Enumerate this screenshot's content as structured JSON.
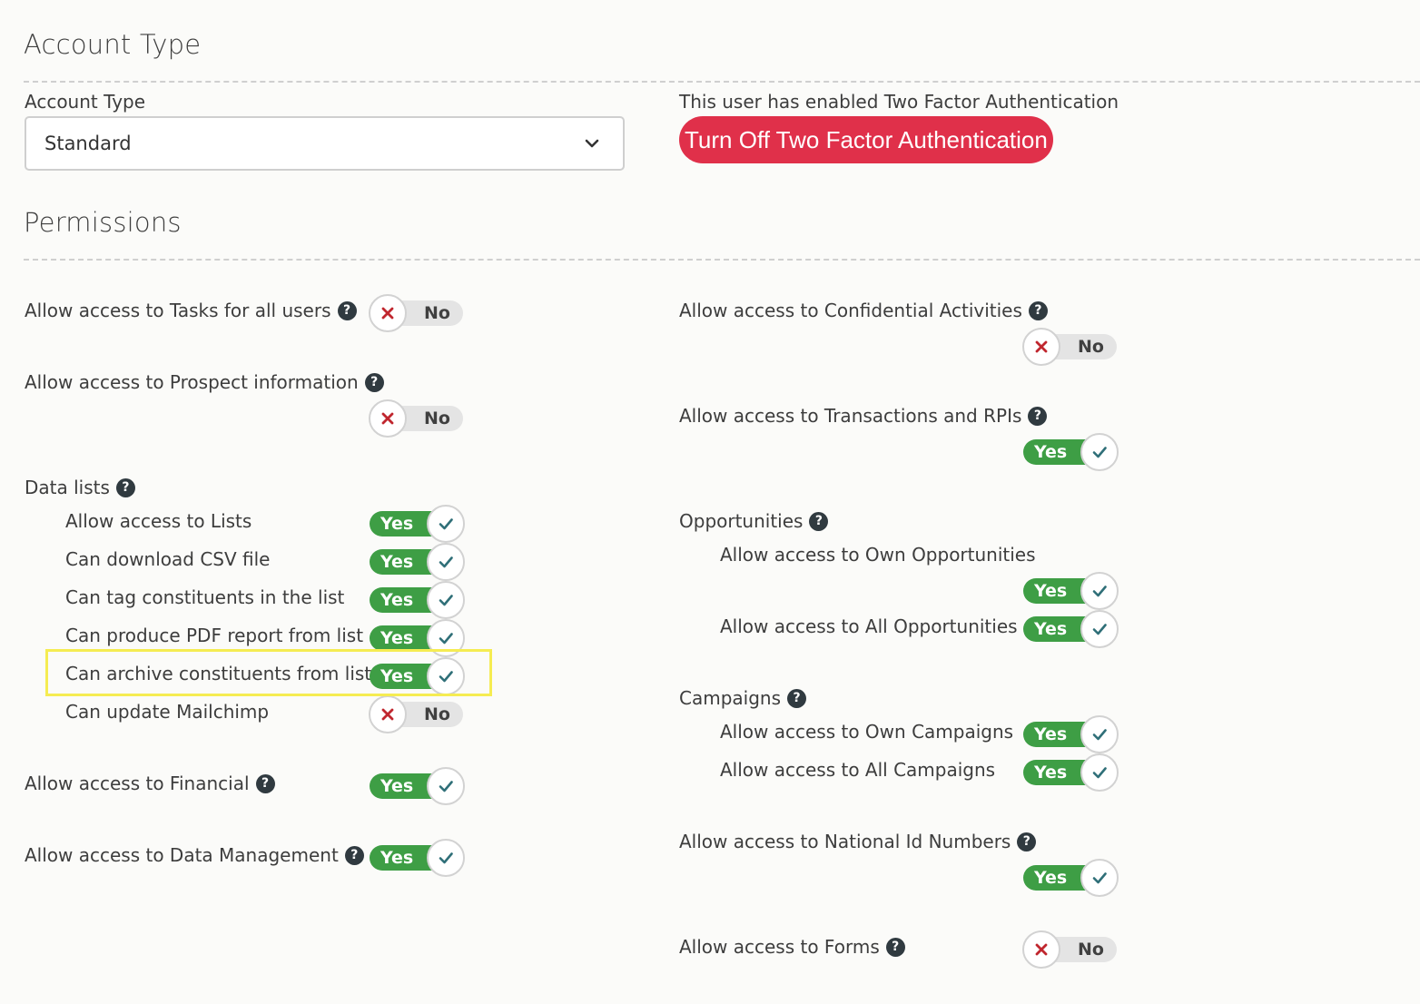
{
  "account": {
    "section_title": "Account Type",
    "field_label": "Account Type",
    "select_value": "Standard",
    "tfa_message": "This user has enabled Two Factor Authentication",
    "tfa_button": "Turn Off Two Factor Authentication"
  },
  "permissions": {
    "section_title": "Permissions",
    "left": {
      "tasks": {
        "label": "Allow access to Tasks for all users",
        "value": "No"
      },
      "prospect": {
        "label": "Allow access to Prospect information",
        "value": "No"
      },
      "data_lists": {
        "label": "Data lists",
        "items": [
          {
            "label": "Allow access to Lists",
            "value": "Yes"
          },
          {
            "label": "Can download CSV file",
            "value": "Yes"
          },
          {
            "label": "Can tag constituents in the list",
            "value": "Yes"
          },
          {
            "label": "Can produce PDF report from list",
            "value": "Yes"
          },
          {
            "label": "Can archive constituents from list",
            "value": "Yes"
          },
          {
            "label": "Can update Mailchimp",
            "value": "No"
          }
        ]
      },
      "financial": {
        "label": "Allow access to Financial",
        "value": "Yes"
      },
      "data_management": {
        "label": "Allow access to Data Management",
        "value": "Yes"
      }
    },
    "right": {
      "confidential": {
        "label": "Allow access to Confidential Activities",
        "value": "No"
      },
      "transactions": {
        "label": "Allow access to Transactions and RPIs",
        "value": "Yes"
      },
      "opportunities": {
        "label": "Opportunities",
        "items": [
          {
            "label": "Allow access to Own Opportunities",
            "value": "Yes"
          },
          {
            "label": "Allow access to All Opportunities",
            "value": "Yes"
          }
        ]
      },
      "campaigns": {
        "label": "Campaigns",
        "items": [
          {
            "label": "Allow access to Own Campaigns",
            "value": "Yes"
          },
          {
            "label": "Allow access to All Campaigns",
            "value": "Yes"
          }
        ]
      },
      "national_id": {
        "label": "Allow access to National Id Numbers",
        "value": "Yes"
      },
      "forms": {
        "label": "Allow access to Forms",
        "value": "No"
      }
    }
  },
  "icons": {
    "help": "question-circle-icon",
    "check": "check-icon",
    "cross": "x-icon",
    "chevron": "chevron-down-icon"
  },
  "colors": {
    "on": "#3e9e45",
    "off": "#e4e4e4",
    "danger": "#e0304a",
    "cross": "#c0262e",
    "check": "#2f6f78",
    "highlight": "#f5ec52"
  }
}
